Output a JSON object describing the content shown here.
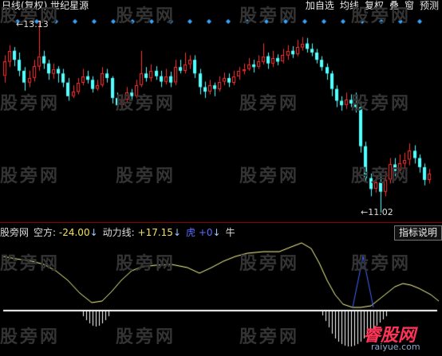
{
  "header": {
    "title": "日线(复权) 世纪星源",
    "menu": [
      "加自选",
      "均线",
      "复权",
      "叠",
      "窗",
      "预测"
    ]
  },
  "main_chart": {
    "high_label": "13.13",
    "low_label": "11.02"
  },
  "indicator": {
    "name": "股旁网",
    "kong_label": "空方:",
    "kong_value": "-24.00",
    "kong_arrow": "↓",
    "dong_label": "动力线:",
    "dong_value": "+17.15",
    "dong_arrow": "↓",
    "hu_label": "虎",
    "hu_value": "+0",
    "hu_arrow": "↓",
    "niu_label": "牛",
    "help_button": "指标说明"
  },
  "watermark": "股旁网",
  "logo": {
    "big": "睿股网",
    "small": "raiyue.com"
  },
  "colors": {
    "up": "#ff3333",
    "down": "#54ffff",
    "line": "#ffff99",
    "peak": "#4466ff",
    "axis": "#8b0000"
  },
  "chart_data": {
    "type": "candlestick",
    "candles": [
      [
        12.52,
        12.68,
        12.75,
        12.45
      ],
      [
        12.68,
        12.8,
        12.86,
        12.62
      ],
      [
        12.8,
        12.7,
        12.84,
        12.63
      ],
      [
        12.7,
        12.58,
        12.78,
        12.52
      ],
      [
        12.58,
        12.45,
        12.62,
        12.36
      ],
      [
        12.45,
        12.5,
        12.58,
        12.4
      ],
      [
        12.5,
        12.63,
        12.7,
        12.46
      ],
      [
        12.63,
        12.74,
        13.13,
        12.58
      ],
      [
        12.74,
        12.66,
        12.8,
        12.6
      ],
      [
        12.66,
        12.55,
        12.7,
        12.48
      ],
      [
        12.55,
        12.6,
        12.66,
        12.49
      ],
      [
        12.6,
        12.55,
        12.63,
        12.45
      ],
      [
        12.55,
        12.45,
        12.6,
        12.4
      ],
      [
        12.45,
        12.3,
        12.5,
        12.25
      ],
      [
        12.3,
        12.35,
        12.42,
        12.28
      ],
      [
        12.35,
        12.45,
        12.5,
        12.32
      ],
      [
        12.45,
        12.52,
        12.6,
        12.42
      ],
      [
        12.52,
        12.48,
        12.58,
        12.44
      ],
      [
        12.48,
        12.38,
        12.52,
        12.34
      ],
      [
        12.38,
        12.42,
        12.48,
        12.36
      ],
      [
        12.42,
        12.55,
        12.62,
        12.4
      ],
      [
        12.55,
        12.5,
        12.6,
        12.45
      ],
      [
        12.5,
        12.28,
        12.52,
        12.22
      ],
      [
        12.28,
        12.2,
        12.34,
        12.15
      ],
      [
        12.2,
        12.26,
        12.32,
        12.16
      ],
      [
        12.26,
        12.34,
        12.4,
        12.22
      ],
      [
        12.34,
        12.3,
        12.38,
        12.25
      ],
      [
        12.3,
        12.42,
        12.48,
        12.28
      ],
      [
        12.42,
        12.55,
        12.8,
        12.4
      ],
      [
        12.55,
        12.5,
        12.62,
        12.46
      ],
      [
        12.5,
        12.58,
        12.65,
        12.46
      ],
      [
        12.58,
        12.52,
        12.63,
        12.48
      ],
      [
        12.52,
        12.46,
        12.58,
        12.4
      ],
      [
        12.46,
        12.52,
        12.6,
        12.43
      ],
      [
        12.52,
        12.45,
        12.57,
        12.4
      ],
      [
        12.45,
        12.62,
        12.7,
        12.42
      ],
      [
        12.62,
        12.58,
        12.7,
        12.55
      ],
      [
        12.58,
        12.65,
        12.78,
        12.55
      ],
      [
        12.65,
        12.7,
        12.75,
        12.6
      ],
      [
        12.7,
        12.55,
        12.75,
        12.5
      ],
      [
        12.55,
        12.4,
        12.6,
        12.32
      ],
      [
        12.4,
        12.35,
        12.46,
        12.28
      ],
      [
        12.35,
        12.42,
        12.48,
        12.32
      ],
      [
        12.42,
        12.38,
        12.45,
        12.3
      ],
      [
        12.38,
        12.46,
        12.52,
        12.35
      ],
      [
        12.46,
        12.5,
        12.56,
        12.42
      ],
      [
        12.5,
        12.45,
        12.55,
        12.4
      ],
      [
        12.45,
        12.52,
        12.58,
        12.42
      ],
      [
        12.52,
        12.58,
        12.62,
        12.48
      ],
      [
        12.58,
        12.6,
        12.66,
        12.54
      ],
      [
        12.6,
        12.65,
        12.72,
        12.58
      ],
      [
        12.65,
        12.62,
        12.7,
        12.56
      ],
      [
        12.62,
        12.68,
        12.75,
        12.6
      ],
      [
        12.68,
        12.74,
        12.88,
        12.65
      ],
      [
        12.74,
        12.66,
        12.78,
        12.6
      ],
      [
        12.66,
        12.72,
        12.8,
        12.62
      ],
      [
        12.72,
        12.68,
        12.76,
        12.64
      ],
      [
        12.68,
        12.75,
        12.82,
        12.66
      ],
      [
        12.75,
        12.8,
        12.86,
        12.7
      ],
      [
        12.8,
        12.76,
        12.85,
        12.72
      ],
      [
        12.76,
        12.84,
        12.92,
        12.74
      ],
      [
        12.84,
        12.88,
        12.95,
        12.8
      ],
      [
        12.88,
        12.82,
        12.94,
        12.78
      ],
      [
        12.82,
        12.78,
        12.88,
        12.74
      ],
      [
        12.78,
        12.7,
        12.82,
        12.66
      ],
      [
        12.7,
        12.62,
        12.74,
        12.58
      ],
      [
        12.62,
        12.55,
        12.66,
        12.48
      ],
      [
        12.55,
        12.38,
        12.58,
        12.3
      ],
      [
        12.38,
        12.25,
        12.42,
        12.18
      ],
      [
        12.25,
        12.2,
        12.3,
        12.14
      ],
      [
        12.2,
        12.26,
        12.34,
        12.16
      ],
      [
        12.26,
        12.22,
        12.32,
        12.18
      ],
      [
        12.22,
        12.18,
        12.34,
        12.12
      ],
      [
        12.18,
        11.75,
        12.24,
        11.68
      ],
      [
        11.75,
        11.4,
        11.8,
        11.36
      ],
      [
        11.4,
        11.28,
        11.45,
        11.2
      ],
      [
        11.28,
        11.35,
        11.42,
        11.24
      ],
      [
        11.35,
        11.25,
        11.45,
        11.02
      ],
      [
        11.25,
        11.38,
        11.48,
        11.2
      ],
      [
        11.38,
        11.55,
        11.62,
        11.34
      ],
      [
        11.55,
        11.48,
        11.62,
        11.42
      ],
      [
        11.48,
        11.56,
        11.66,
        11.46
      ],
      [
        11.56,
        11.6,
        11.68,
        11.5
      ],
      [
        11.6,
        11.7,
        11.78,
        11.54
      ],
      [
        11.7,
        11.62,
        11.76,
        11.56
      ],
      [
        11.62,
        11.52,
        11.66,
        11.46
      ],
      [
        11.52,
        11.38,
        11.56,
        11.32
      ],
      [
        11.38,
        11.45,
        11.5,
        11.34
      ]
    ]
  }
}
